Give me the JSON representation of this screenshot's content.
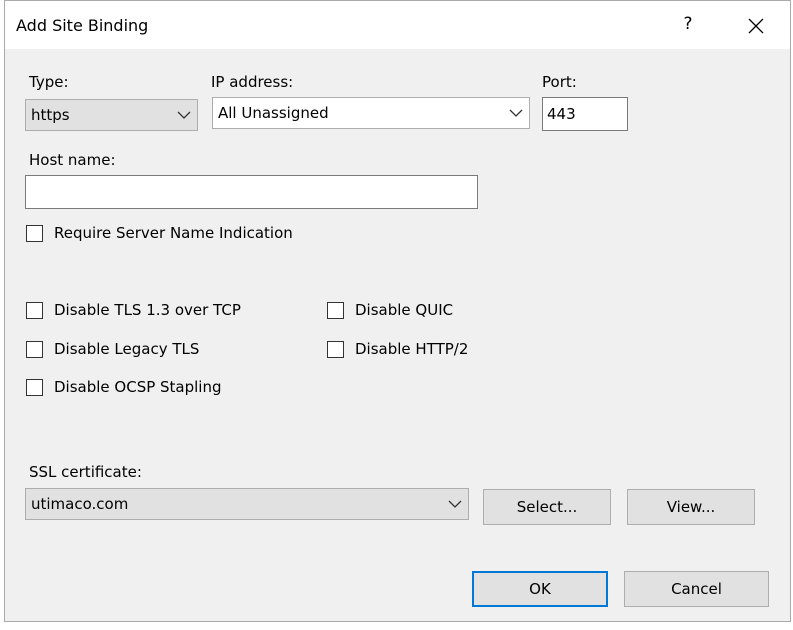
{
  "dialog": {
    "title": "Add Site Binding",
    "help_label": "?",
    "type_label": "Type:",
    "type_value": "https",
    "ip_label": "IP address:",
    "ip_value": "All Unassigned",
    "port_label": "Port:",
    "port_value": "443",
    "hostname_label": "Host name:",
    "hostname_value": "",
    "sni_label": "Require Server Name Indication",
    "tls13_label": "Disable TLS 1.3 over TCP",
    "quic_label": "Disable QUIC",
    "legacy_tls_label": "Disable Legacy TLS",
    "http2_label": "Disable HTTP/2",
    "ocsp_label": "Disable OCSP Stapling",
    "ssl_label": "SSL certificate:",
    "ssl_value": "utimaco.com",
    "select_label": "Select...",
    "view_label": "View...",
    "ok_label": "OK",
    "cancel_label": "Cancel"
  }
}
